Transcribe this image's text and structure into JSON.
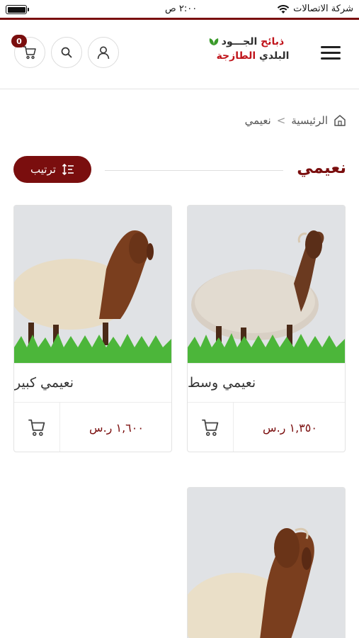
{
  "status_bar": {
    "carrier": "شركة الاتصالات",
    "time": "٢:٠٠ ص"
  },
  "header": {
    "logo_line1_red": "ذبائح",
    "logo_line1": "الجـــود",
    "logo_line2": "البلدي",
    "logo_line2_red": "الطازجة",
    "cart_count": "0",
    "icons": {
      "menu": "hamburger-menu-icon",
      "user": "user-icon",
      "search": "search-icon",
      "cart": "cart-icon"
    }
  },
  "breadcrumb": {
    "home": "الرئيسية",
    "separator": "<",
    "current": "نعيمي"
  },
  "page": {
    "title": "نعيمي",
    "sort_label": "ترتيب"
  },
  "products": [
    {
      "name": "نعيمي وسط",
      "price": "١,٣٥٠ ر.س"
    },
    {
      "name": "نعيمي كبير",
      "price": "١,٦٠٠ ر.س"
    },
    {
      "name": "",
      "price": ""
    }
  ],
  "colors": {
    "brand": "#7a0e0e",
    "logo_red": "#c0141b",
    "logo_green": "#3a9a2a"
  }
}
